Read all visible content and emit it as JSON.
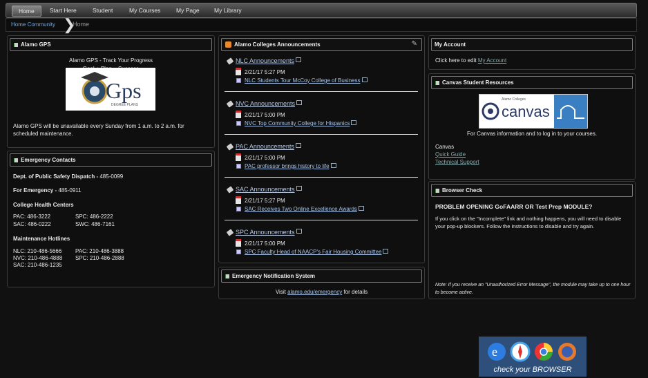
{
  "nav": [
    "Home",
    "Start Here",
    "Student",
    "My Courses",
    "My Page",
    "My Library"
  ],
  "breadcrumb": {
    "home": "Home Community",
    "current": "Home"
  },
  "gps": {
    "title": "Alamo GPS",
    "heading1": "Alamo GPS - Track Your Progress",
    "heading2": "Goal + Plan = Success",
    "notice": "Alamo GPS will be unavailable every Sunday from 1 a.m. to 2 a.m. for scheduled maintenance.",
    "logo_text": "Gps",
    "logo_sub": "DEGREE PLANS"
  },
  "emergency": {
    "title": "Emergency Contacts",
    "dispatch_label": "Dept. of Public Safety Dispatch - ",
    "dispatch_num": "485-0099",
    "emergency_label": "For Emergency - ",
    "emergency_num": "485-0911",
    "health_title": "College Health Centers",
    "pac": "PAC: 486-3222",
    "spc": "SPC: 486-2222",
    "sac": "SAC: 486-0222",
    "swc": "SWC: 486-7161",
    "maint_title": "Maintenance Hotlines",
    "m_nlc": "NLC: 210-486-5666",
    "m_pac": "PAC: 210-486-3888",
    "m_nvc": "NVC: 210-486-4888",
    "m_spc": "SPC: 210-486-2888",
    "m_sac": "SAC: 210-486-1235"
  },
  "announcements": {
    "title": "Alamo Colleges Announcements",
    "groups": [
      {
        "name": "NLC Announcements",
        "date": "2/21/17 5:27 PM",
        "item": "NLC Students Tour McCoy College of Business"
      },
      {
        "name": "NVC Announcements",
        "date": "2/21/17 5:00 PM",
        "item": "NVC Top Community College for Hispanics"
      },
      {
        "name": "PAC Announcements",
        "date": "2/21/17 5:00 PM",
        "item": "PAC professor brings history to life"
      },
      {
        "name": "SAC Announcements",
        "date": "2/21/17 5:27 PM",
        "item": "SAC Receives Two Online Excellence Awards"
      },
      {
        "name": "SPC Announcements",
        "date": "2/21/17 5:00 PM",
        "item": "SPC Faculty Head of NAACP's Fair Housing Committee"
      }
    ]
  },
  "notification": {
    "title": "Emergency Notification System",
    "visit": "Visit ",
    "link": "alamo.edu/emergency",
    "tail": " for details"
  },
  "account": {
    "title": "My Account",
    "text": "Click here to edit ",
    "link": "My Account"
  },
  "canvas": {
    "title": "Canvas Student Resources",
    "logo_top": "Alamo Colleges",
    "logo": "canvas",
    "info": "For Canvas information and to log in to your courses.",
    "label": "Canvas",
    "link1": "Quick Guide",
    "link2": "Technical Support"
  },
  "browser": {
    "title": "Browser Check",
    "heading": "PROBLEM OPENING GoFAARR OR Test Prep MODULE?",
    "text": "If you click on the \"Incomplete\" link and nothing happens, you will need to disable your pop-up blockers. Follow the instructions to disable and try again.",
    "banner": "check your BROWSER",
    "note": "Note: If you receive an \"Unauthorized Error Message\", the module may take up to one hour to become active."
  }
}
